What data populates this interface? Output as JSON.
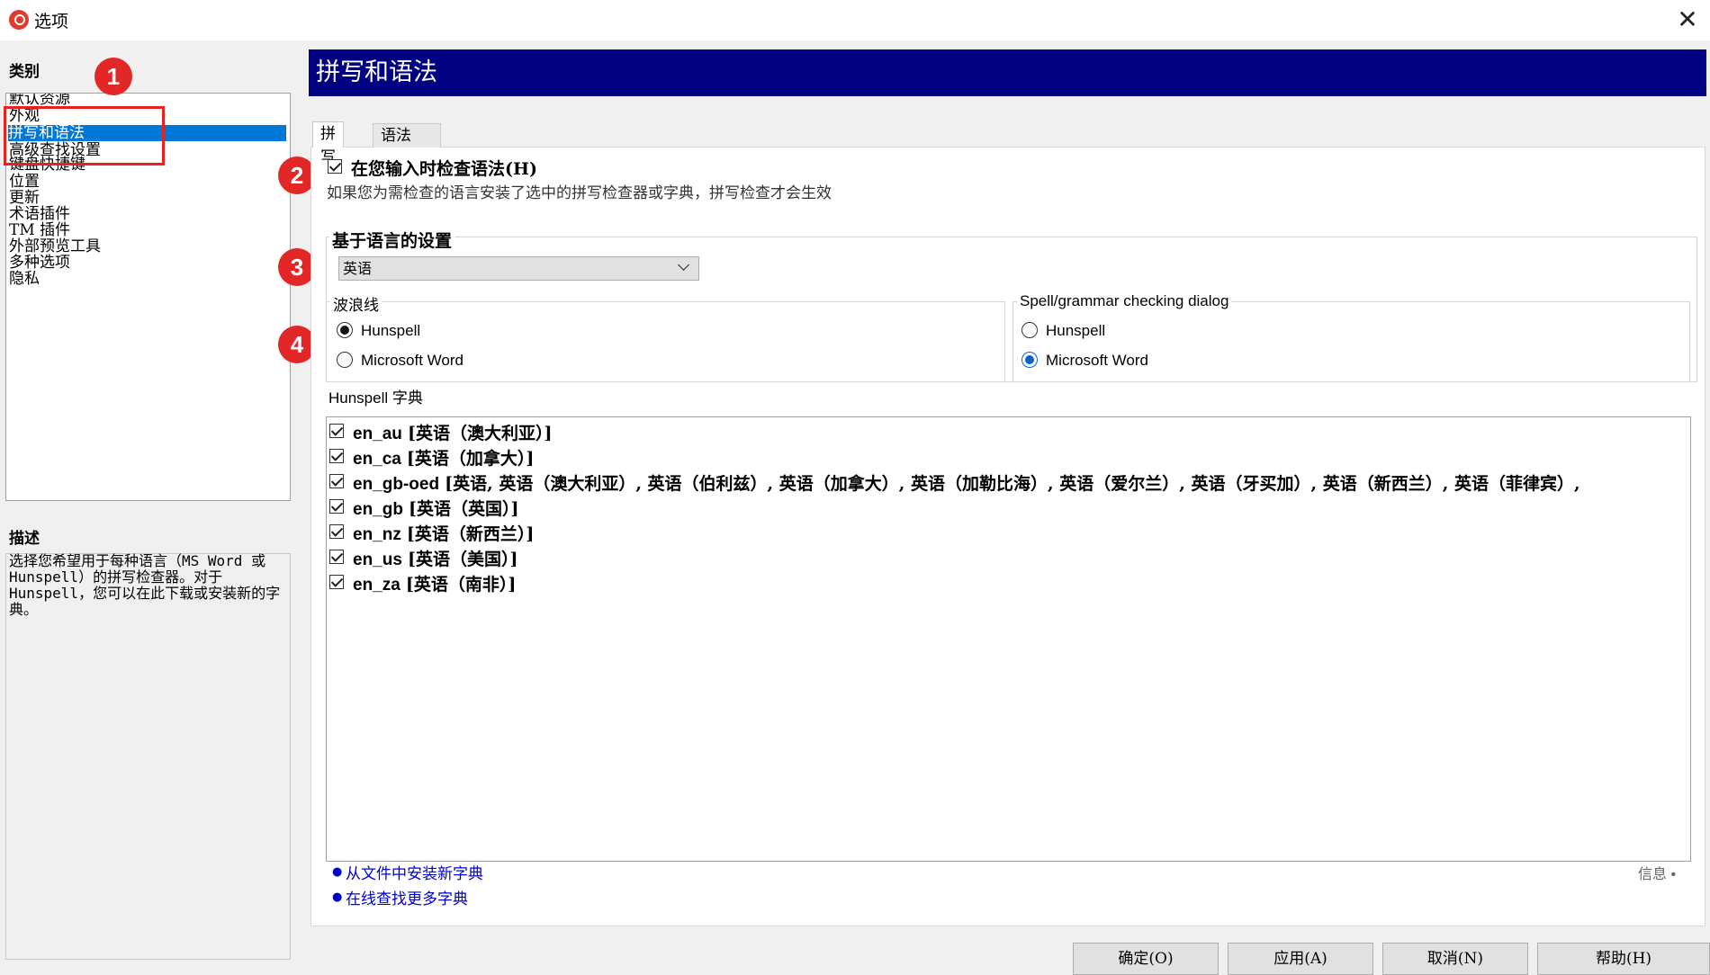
{
  "window": {
    "title": "选项",
    "close_glyph": "✕"
  },
  "sidebar": {
    "category_label": "类别",
    "items": [
      "默认资源",
      "外观",
      "拼写和语法",
      "高级查找设置",
      "键盘快捷键",
      "位置",
      "更新",
      "术语插件",
      "TM 插件",
      "外部预览工具",
      "多种选项",
      "隐私"
    ],
    "selected_index": 2,
    "description_label": "描述",
    "description": "选择您希望用于每种语言（MS Word 或 Hunspell）的拼写检查器。对于 Hunspell，您可以在此下载或安装新的字典。"
  },
  "annotations": [
    "1",
    "2",
    "3",
    "4"
  ],
  "header": {
    "title": "拼写和语法"
  },
  "tabs": [
    {
      "label": "拼写",
      "active": true
    },
    {
      "label": "语法",
      "active": false
    }
  ],
  "check_while_typing": {
    "label": "在您输入时检查语法(H)",
    "checked": true,
    "hint": "如果您为需检查的语言安装了选中的拼写检查器或字典，拼写检查才会生效"
  },
  "language_settings": {
    "label": "基于语言的设置",
    "selected_language": "英语",
    "wavy_line": {
      "label": "波浪线",
      "options": [
        "Hunspell",
        "Microsoft Word"
      ],
      "selected": "Hunspell"
    },
    "dialog": {
      "label": "Spell/grammar checking dialog",
      "options": [
        "Hunspell",
        "Microsoft Word"
      ],
      "selected": "Microsoft Word"
    }
  },
  "dictionaries": {
    "label": "Hunspell 字典",
    "items": [
      {
        "code": "en_au",
        "name": "[英语（澳大利亚）]",
        "checked": true
      },
      {
        "code": "en_ca",
        "name": "[英语（加拿大）]",
        "checked": true
      },
      {
        "code": "en_gb-oed",
        "name": "[英语, 英语（澳大利亚）, 英语（伯利兹）, 英语（加拿大）, 英语（加勒比海）, 英语（爱尔兰）, 英语（牙买加）, 英语（新西兰）, 英语（菲律宾）,",
        "checked": true
      },
      {
        "code": "en_gb",
        "name": "[英语（英国）]",
        "checked": true
      },
      {
        "code": "en_nz",
        "name": "[英语（新西兰）]",
        "checked": true
      },
      {
        "code": "en_us",
        "name": "[英语（美国）]",
        "checked": true
      },
      {
        "code": "en_za",
        "name": "[英语（南非）]",
        "checked": true
      }
    ]
  },
  "links": {
    "install_from_file": "从文件中安装新字典",
    "find_online": "在线查找更多字典",
    "info": "信息 •"
  },
  "buttons": {
    "ok": "确定(O)",
    "apply": "应用(A)",
    "cancel": "取消(N)",
    "help": "帮助(H)"
  }
}
